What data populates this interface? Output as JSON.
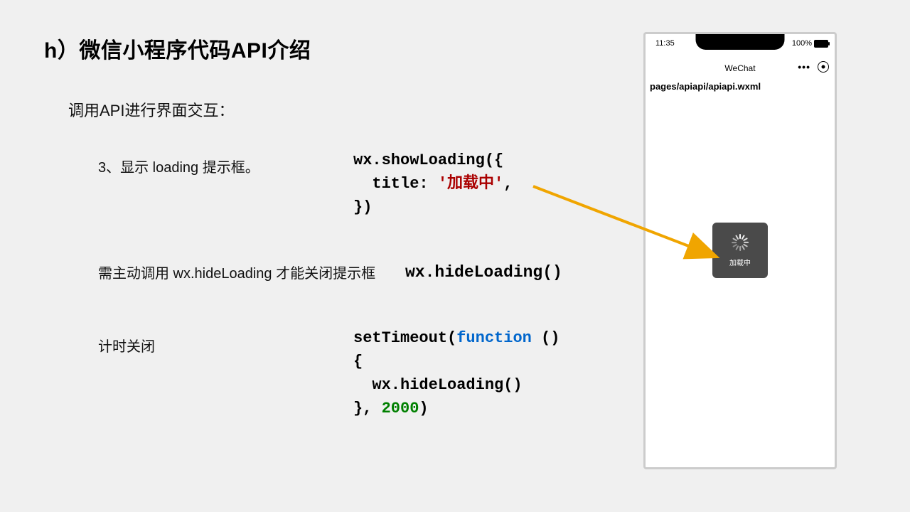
{
  "title": "h）微信小程序代码API介绍",
  "subtitle": "调用API进行界面交互：",
  "bullets": {
    "b1": "3、显示 loading 提示框。",
    "b2": "需主动调用 wx.hideLoading 才能关闭提示框",
    "b3": "计时关闭"
  },
  "code": {
    "show": {
      "l1": "wx.showLoading({",
      "l2a": "  title: ",
      "l2b": "'加载中'",
      "l2c": ",",
      "l3": "})"
    },
    "hide": "wx.hideLoading()",
    "timeout": {
      "l1a": "setTimeout(",
      "l1b": "function",
      "l1c": " ()",
      "l2": "{",
      "l3": "  wx.hideLoading()",
      "l4a": "}, ",
      "l4b": "2000",
      "l4c": ")"
    }
  },
  "phone": {
    "time": "11:35",
    "battery": "100%",
    "appTitle": "WeChat",
    "pagePath": "pages/apiapi/apiapi.wxml",
    "toastText": "加载中"
  }
}
